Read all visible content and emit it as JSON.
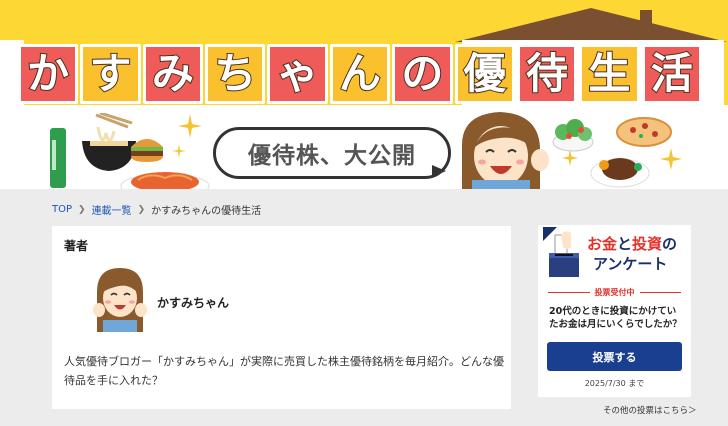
{
  "banner": {
    "title_chars": [
      "か",
      "す",
      "み",
      "ち",
      "ゃ",
      "ん",
      "の",
      "優",
      "待",
      "生",
      "活"
    ],
    "bubble_text": "優待株、大公開"
  },
  "breadcrumb": {
    "items": [
      "TOP",
      "連載一覧",
      "かすみちゃんの優待生活"
    ]
  },
  "author": {
    "heading": "著者",
    "name": "かすみちゃん",
    "description": "人気優待ブロガー「かすみちゃん」が実際に売買した株主優待銘柄を毎月紹介。どんな優待品を手に入れた？"
  },
  "survey": {
    "title_part1": "お金",
    "title_part2": "と",
    "title_part3": "投資",
    "title_part4": "の",
    "title_line2": "アンケート",
    "status": "投票受付中",
    "question": "20代のときに投資にかけていたお金は月にいくらでしたか？",
    "vote_label": "投票する",
    "deadline": "2025/7/30 まで",
    "other_link": "その他の投票はこちら＞"
  },
  "colors": {
    "banner_yellow": "#fdd835",
    "tile_red": "#ef5b59",
    "tile_orange": "#fbc02d",
    "link_blue": "#1a56b7",
    "button_navy": "#1a3f91",
    "accent_red": "#e3322b"
  }
}
